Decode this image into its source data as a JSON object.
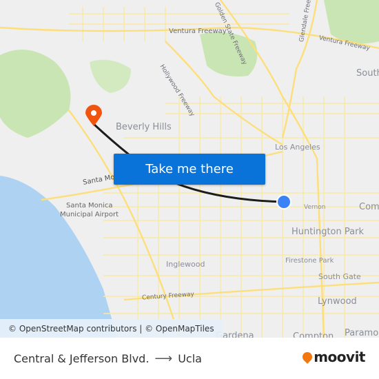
{
  "map": {
    "labels": {
      "beverly_hills": "Beverly Hills",
      "los_angeles": "Los Angeles",
      "santa_monica_road": "Santa Moni",
      "santa_monica_airport_1": "Santa Monica",
      "santa_monica_airport_2": "Municipal Airport",
      "vernon": "Vernon",
      "huntington_park": "Huntington Park",
      "firestone_park": "Firestone Park",
      "south_gate": "South Gate",
      "lynwood": "Lynwood",
      "inglewood": "Inglewood",
      "century_freeway": "Century Freeway",
      "gardena": "Gardena",
      "compton": "Compton",
      "paramount": "Paramo",
      "commerce": "Com",
      "south_pasadena": "South",
      "ventura_freeway_1": "Ventura Freeway",
      "ventura_freeway_2": "Ventura Freeway",
      "hollywood_freeway": "Hollywood Freeway",
      "golden_state_freeway": "Golden State Freeway",
      "glendale_freeway": "Glendale Freeway"
    },
    "origin_marker": "origin-dot",
    "destination_marker": "destination-pin",
    "colors": {
      "route": "#1c1c1c",
      "origin": "#3b82f6",
      "destination": "#f1540e",
      "water": "#aed3f2",
      "park": "#c9e5b4",
      "road": "#fdf0b0"
    }
  },
  "cta": {
    "label": "Take me there"
  },
  "attribution": {
    "text": "© OpenStreetMap contributors | © OpenMapTiles"
  },
  "footer": {
    "origin": "Central & Jefferson Blvd.",
    "arrow": "⟶",
    "destination": "Ucla",
    "brand": "moovit"
  }
}
